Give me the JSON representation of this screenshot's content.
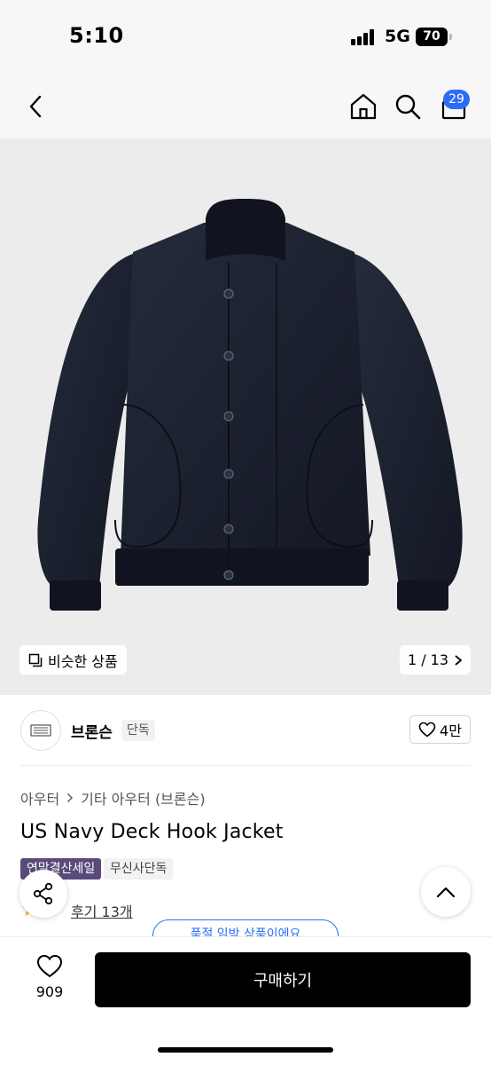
{
  "status_bar": {
    "time": "5:10",
    "network": "5G",
    "battery": "70"
  },
  "nav": {
    "back_icon": "chevron-left-icon",
    "home_icon": "home-icon",
    "search_icon": "search-icon",
    "cart_icon": "cart-icon",
    "cart_count": "29"
  },
  "hero": {
    "similar_label": "비슷한 상품",
    "pager": "1 / 13"
  },
  "brand": {
    "name": "브론슨",
    "tag": "단독",
    "likes": "4만"
  },
  "breadcrumb": {
    "level1": "아우터",
    "level2": "기타 아우터 (브론슨)"
  },
  "product": {
    "title": "US Navy Deck Hook Jacket",
    "tags": [
      "연말결산세일",
      "무신사단독"
    ],
    "reviews": "후기 13개",
    "pill_peek": "품절 임박 상품이에요"
  },
  "bottom_bar": {
    "wishlist_count": "909",
    "buy_label": "구매하기"
  },
  "colors": {
    "accent": "#2a6df4",
    "jacket": "#1c2130",
    "sale_tag": "#5a4a7a"
  }
}
